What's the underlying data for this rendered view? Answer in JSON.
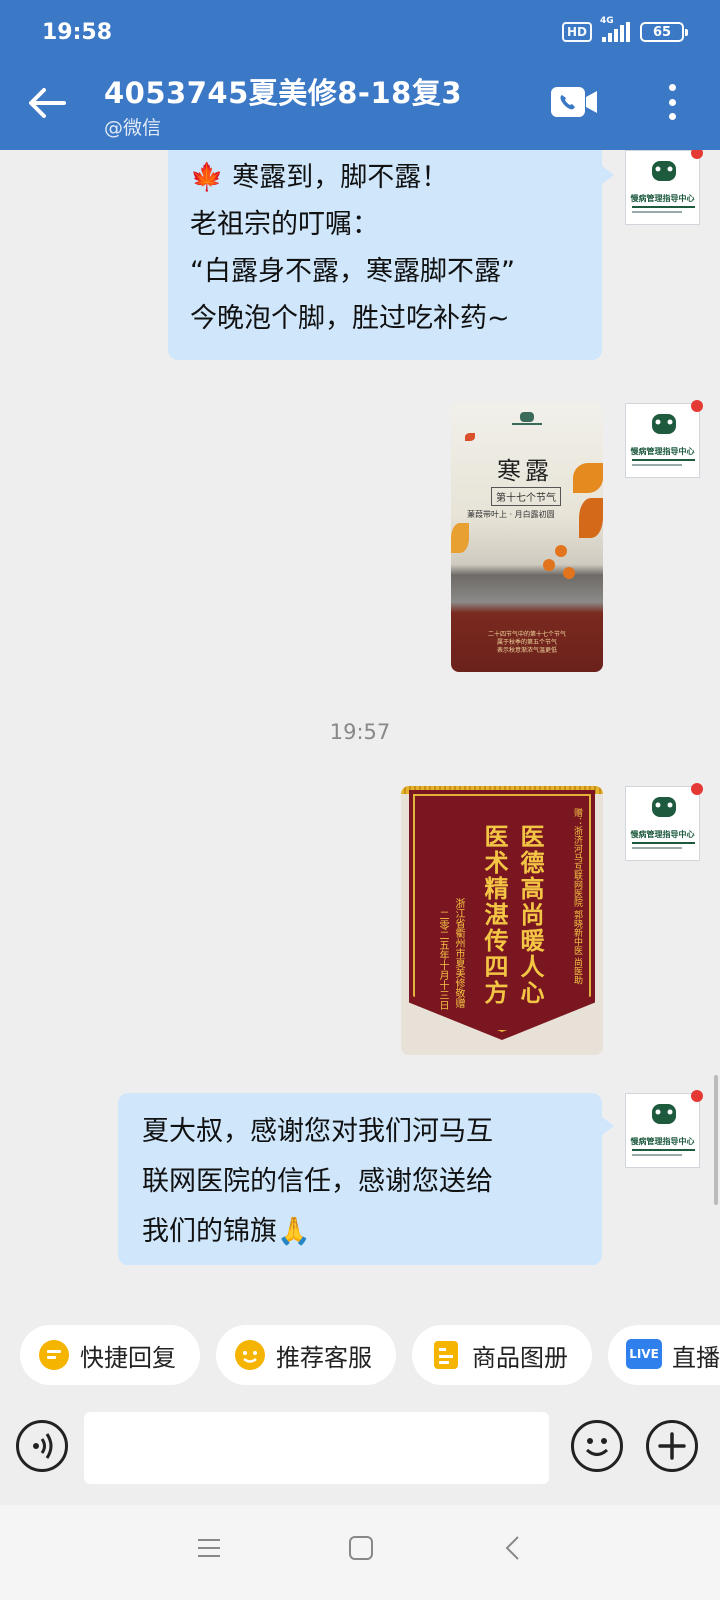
{
  "status_bar": {
    "time": "19:58",
    "hd": "HD",
    "network": "4G",
    "battery": "65"
  },
  "header": {
    "title": "4053745夏美修8-18复3",
    "subtitle": "@微信"
  },
  "messages": {
    "m1": {
      "line1": "寒露到，脚不露！",
      "line2": "老祖宗的叮嘱：",
      "line3": "“白露身不露，寒露脚不露”",
      "line4": "今晚泡个脚，胜过吃补药~"
    },
    "time_divider": "19:57",
    "m4": {
      "line1": "夏大叔，感谢您对我们河马互",
      "line2": "联网医院的信任，感谢您送给",
      "line3": "我们的锦旗🙏"
    }
  },
  "poster": {
    "title": "寒露",
    "subtitle": "第十七个节气",
    "line": "蒹葭带叶上 · 月白露初圆",
    "footer1": "二十四节气中的第十七个节气",
    "footer2": "属于秋季的第五个节气",
    "footer3": "表示秋意渐浓气温更低"
  },
  "banner": {
    "top_right": "赠：浙济河马互联网医院 郭晓新中医 尚医助",
    "col1": "医德高尚暖人心",
    "col2": "医术精湛传四方",
    "col3": "浙江省衢州市夏美修敬赠",
    "col4": "二零二五年十月十三日"
  },
  "avatar": {
    "org_name": "慢病管理指导中心"
  },
  "quick_replies": [
    {
      "label": "快捷回复",
      "icon": "quick-reply-icon"
    },
    {
      "label": "推荐客服",
      "icon": "service-icon"
    },
    {
      "label": "商品图册",
      "icon": "catalog-icon"
    },
    {
      "label": "直播",
      "icon": "live-icon",
      "badge": "LIVE"
    }
  ],
  "input": {
    "placeholder": ""
  },
  "colors": {
    "header": "#3b78c6",
    "bubble": "#cfe6fb",
    "chip_icon": "#f4b400",
    "live": "#2f80ed"
  }
}
